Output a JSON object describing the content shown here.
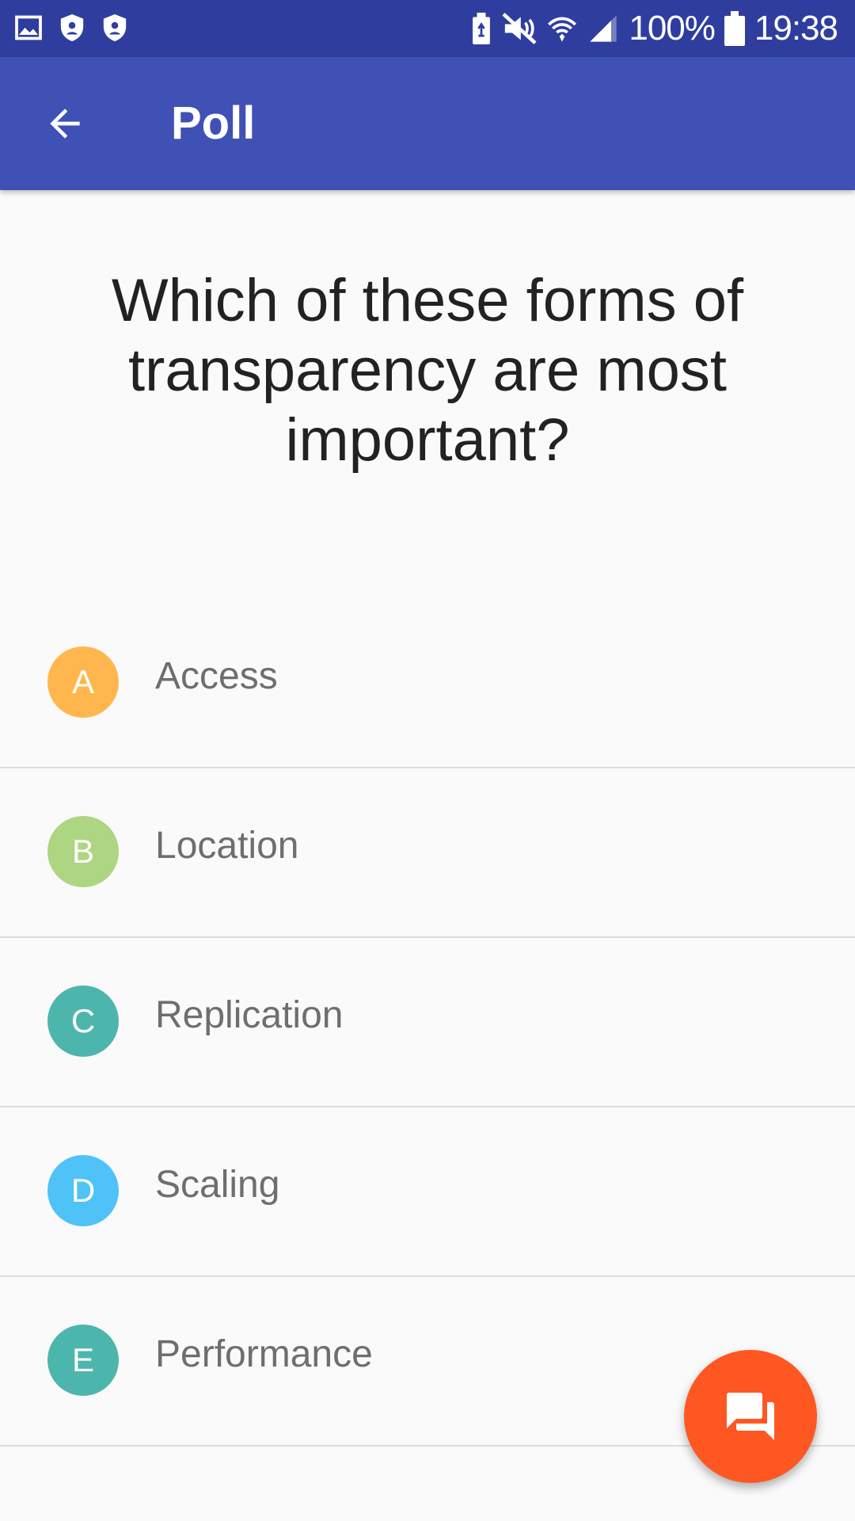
{
  "status_bar": {
    "battery": "100%",
    "time": "19:38",
    "icons_left": [
      "image-icon",
      "shield-icon",
      "shield-icon"
    ],
    "icons_right": [
      "battery-saver-icon",
      "mute-icon",
      "wifi-icon",
      "signal-icon",
      "battery-icon"
    ],
    "color": "#2f3e9e"
  },
  "app_bar": {
    "title": "Poll",
    "back_icon": "arrow-left-icon",
    "color": "#3f51b5"
  },
  "question": "Which of these forms of transparency are most important?",
  "options": [
    {
      "letter": "A",
      "label": "Access",
      "color": "#ffb74d"
    },
    {
      "letter": "B",
      "label": "Location",
      "color": "#aed581"
    },
    {
      "letter": "C",
      "label": "Replication",
      "color": "#4db6ac"
    },
    {
      "letter": "D",
      "label": "Scaling",
      "color": "#4fc3f7"
    },
    {
      "letter": "E",
      "label": "Performance",
      "color": "#4db6ac"
    }
  ],
  "fab": {
    "icon": "forum-chat-icon",
    "color": "#ff5722"
  }
}
